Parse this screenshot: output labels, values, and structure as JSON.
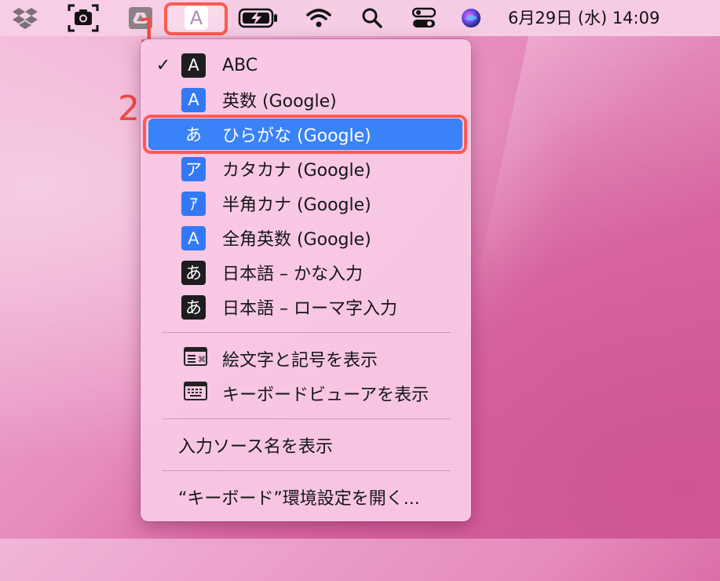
{
  "menubar": {
    "clock": "6月29日 (水)  14:09",
    "icons": [
      "dropbox-icon",
      "screenshot-icon",
      "drive-icon",
      "input-source-icon",
      "battery-icon",
      "wifi-icon",
      "search-icon",
      "control-center-icon",
      "siri-icon"
    ],
    "input_source_glyph": "A"
  },
  "annotations": {
    "step1": "1",
    "step2": "2"
  },
  "menu": {
    "sources": [
      {
        "label": "ABC",
        "glyph": "A",
        "style": "dark",
        "checked": true
      },
      {
        "label": "英数 (Google)",
        "glyph": "A",
        "style": "blue",
        "checked": false
      },
      {
        "label": "ひらがな (Google)",
        "glyph": "あ",
        "style": "blue",
        "checked": false,
        "selected": true
      },
      {
        "label": "カタカナ (Google)",
        "glyph": "ア",
        "style": "blue",
        "checked": false
      },
      {
        "label": "半角カナ (Google)",
        "glyph": "ｱ",
        "style": "blue",
        "checked": false
      },
      {
        "label": "全角英数 (Google)",
        "glyph": "Ａ",
        "style": "blue",
        "checked": false
      },
      {
        "label": "日本語 – かな入力",
        "glyph": "あ",
        "style": "dark",
        "checked": false
      },
      {
        "label": "日本語 – ローマ字入力",
        "glyph": "あ",
        "style": "dark",
        "checked": false
      }
    ],
    "check_mark": "✓",
    "tools": [
      {
        "label": "絵文字と記号を表示",
        "icon": "emoji-viewer-icon"
      },
      {
        "label": "キーボードビューアを表示",
        "icon": "keyboard-viewer-icon"
      }
    ],
    "show_name": "入力ソース名を表示",
    "open_prefs": "“キーボード”環境設定を開く..."
  },
  "colors": {
    "highlight": "#3a82f7",
    "annotation_red": "#ff5a52",
    "badge_blue": "#3478f6",
    "badge_dark": "#1f1c20"
  }
}
